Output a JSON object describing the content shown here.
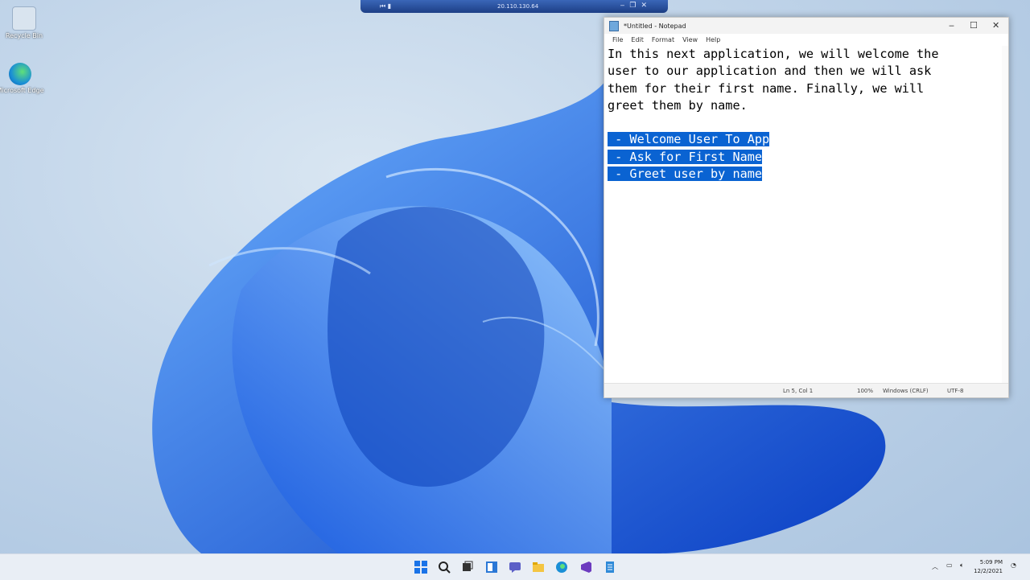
{
  "desktop": {
    "icons": [
      {
        "label": "Recycle Bin",
        "icon": "recycle-bin-icon"
      },
      {
        "label": "Microsoft Edge",
        "icon": "edge-icon"
      }
    ]
  },
  "rdp_bar": {
    "host": "20.110.130.64"
  },
  "notepad": {
    "title": "*Untitled - Notepad",
    "menu": [
      "File",
      "Edit",
      "Format",
      "View",
      "Help"
    ],
    "text_lines": [
      "In this next application, we will welcome the",
      "user to our application and then we will ask",
      "them for their first name. Finally, we will",
      "greet them by name.",
      ""
    ],
    "selected_lines": [
      " - Welcome User To App",
      " - Ask for First Name",
      " - Greet user by name"
    ],
    "status": {
      "position": "Ln 5, Col 1",
      "zoom": "100%",
      "line_ending": "Windows (CRLF)",
      "encoding": "UTF-8"
    }
  },
  "taskbar": {
    "apps": [
      "start-icon",
      "search-icon",
      "task-view-icon",
      "widgets-icon",
      "chat-icon",
      "file-explorer-icon",
      "edge-icon",
      "visual-studio-icon",
      "notepad-icon"
    ],
    "clock": {
      "time": "5:09 PM",
      "date": "12/2/2021"
    }
  },
  "colors": {
    "selection": "#0a63d2",
    "rdp_bar": "#2b55a8"
  }
}
